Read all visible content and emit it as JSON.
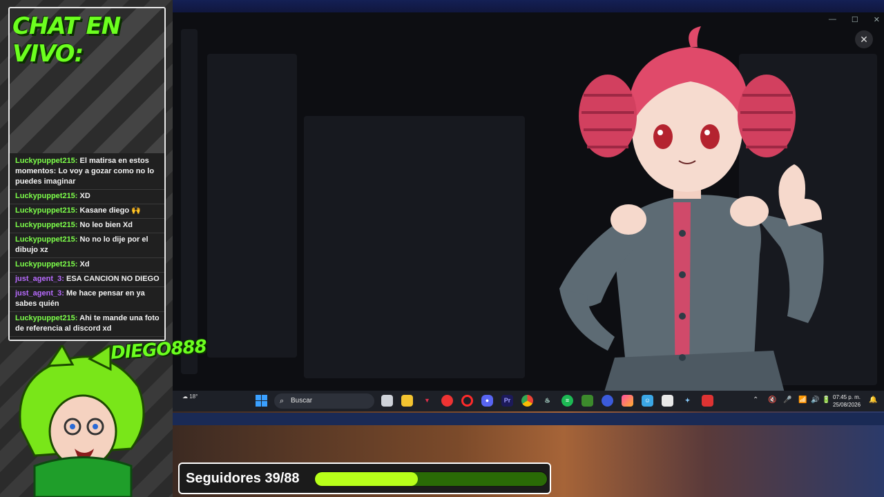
{
  "chat": {
    "title": "CHAT EN VIVO:",
    "messages": [
      {
        "user": "Luckypuppet215:",
        "text": "El matirsa en estos momentos: Lo voy a gozar como no lo puedes imaginar",
        "color": "green"
      },
      {
        "user": "Luckypuppet215:",
        "text": "XD",
        "color": "green"
      },
      {
        "user": "Luckypuppet215:",
        "text": "Kasane diego 🙌",
        "color": "green"
      },
      {
        "user": "Luckypuppet215:",
        "text": "No leo bien Xd",
        "color": "green"
      },
      {
        "user": "Luckypuppet215:",
        "text": "No no lo dije por el dibujo xz",
        "color": "green"
      },
      {
        "user": "Luckypuppet215:",
        "text": "Xd",
        "color": "green"
      },
      {
        "user": "just_agent_3:",
        "text": "ESA CANCION NO DIEGO",
        "color": "purple"
      },
      {
        "user": "just_agent_3:",
        "text": "Me hace pensar en ya sabes quién",
        "color": "purple"
      },
      {
        "user": "Luckypuppet215:",
        "text": "Ahi te mande una foto de referencia al discord xd",
        "color": "green"
      }
    ]
  },
  "streamer": {
    "name": "DIEGO888"
  },
  "window": {
    "close_icon": "close-icon"
  },
  "taskbar": {
    "weather": "18°",
    "search_label": "Buscar",
    "clock_time": "07:45 p. m.",
    "clock_date": "25/08/2026",
    "apps": [
      "file-explorer",
      "files",
      "trident",
      "browser",
      "opera",
      "discord",
      "premiere",
      "chrome",
      "steam",
      "spotify",
      "minecraft",
      "app",
      "app",
      "app",
      "store",
      "app",
      "app"
    ]
  },
  "goal": {
    "label": "Seguidores 39/88",
    "current": 39,
    "target": 88
  },
  "colors": {
    "chat_green": "#7dff4a",
    "chat_purple": "#b86bff",
    "goal_fill": "#b8ff1a",
    "goal_track": "#2a6a06"
  }
}
